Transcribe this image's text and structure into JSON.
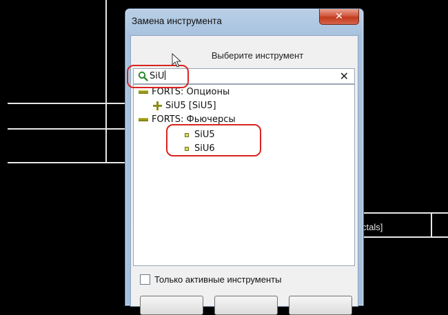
{
  "window": {
    "title": "Замена инструмента",
    "close_glyph": "✕"
  },
  "dialog": {
    "prompt": "Выберите инструмент",
    "search": {
      "value": "SiU",
      "clear_glyph": "✕"
    },
    "tree": [
      {
        "label": "FORTS: Опционы",
        "kind": "group-expanded",
        "icon": "minus-icon"
      },
      {
        "label": "SiU5 [SiU5]",
        "kind": "group-collapsed",
        "icon": "plus-icon"
      },
      {
        "label": "FORTS: Фьючерсы",
        "kind": "group-expanded",
        "icon": "minus-icon"
      },
      {
        "label": "SiU5",
        "kind": "leaf",
        "icon": "leaf-square-icon"
      },
      {
        "label": "SiU6",
        "kind": "leaf",
        "icon": "leaf-square-icon"
      }
    ],
    "active_only": {
      "label": "Только активные инструменты",
      "checked": false
    }
  },
  "background": {
    "fragment_text": "ctals]"
  },
  "colors": {
    "annotation": "#d9231f",
    "tree_icon": "#9a9a1a"
  }
}
